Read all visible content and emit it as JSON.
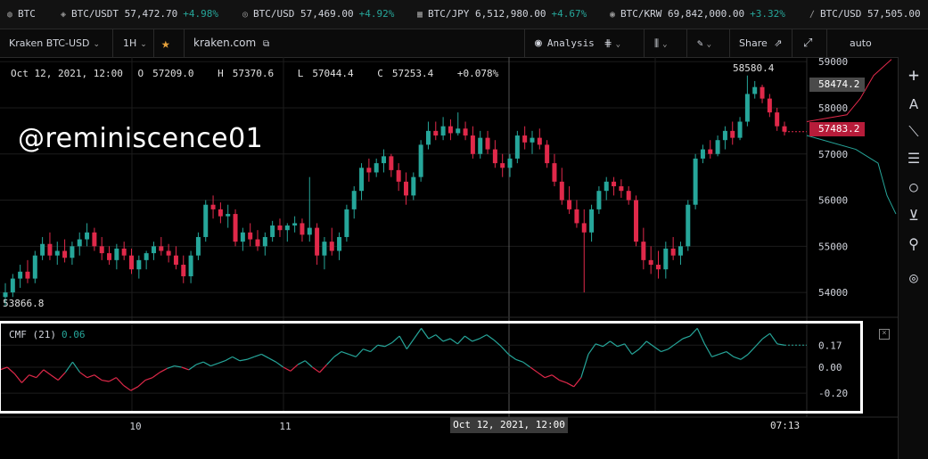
{
  "ticker": [
    {
      "icon": "btc-icon",
      "glyph": "◍",
      "pair": "BTC",
      "price": "",
      "change": ""
    },
    {
      "icon": "usdt-icon",
      "glyph": "◈",
      "pair": "BTC/USDT",
      "price": "57,472.70",
      "change": "+4.98%"
    },
    {
      "icon": "usd-icon",
      "glyph": "◎",
      "pair": "BTC/USD",
      "price": "57,469.00",
      "change": "+4.92%"
    },
    {
      "icon": "jpy-icon",
      "glyph": "▦",
      "pair": "BTC/JPY",
      "price": "6,512,980.00",
      "change": "+4.67%"
    },
    {
      "icon": "krw-icon",
      "glyph": "◉",
      "pair": "BTC/KRW",
      "price": "69,842,000.00",
      "change": "+3.32%"
    },
    {
      "icon": "usd-icon",
      "glyph": "∕",
      "pair": "BTC/USD",
      "price": "57,505.00",
      "change": ""
    }
  ],
  "toolbar": {
    "symbol": "Kraken BTC-USD",
    "interval": "1H",
    "site": "kraken.com",
    "analysis": "Analysis",
    "share": "Share",
    "auto": "auto"
  },
  "ohlc": {
    "date": "Oct 12, 2021, 12:00",
    "o_label": "O",
    "o": "57209.0",
    "h_label": "H",
    "h": "57370.6",
    "l_label": "L",
    "l": "57044.4",
    "c_label": "C",
    "c": "57253.4",
    "change": "+0.078%"
  },
  "watermark": "@reminiscence01",
  "price_labels": {
    "high_marker": "58580.4",
    "low_marker": "53866.8",
    "last_gray": "58474.2",
    "last_red": "57483.2"
  },
  "indicator": {
    "name": "CMF (21)",
    "value": "0.06"
  },
  "crosshair_time": "Oct 12, 2021, 12:00",
  "time_now": "07:13",
  "chart_data": {
    "type": "candlestick",
    "price_axis": {
      "ticks": [
        "59000",
        "58000",
        "57000",
        "56000",
        "55000",
        "54000"
      ],
      "values": [
        59000,
        58000,
        57000,
        56000,
        55000,
        54000
      ],
      "range": [
        53500,
        59100
      ]
    },
    "time_axis": {
      "ticks": [
        "10",
        "11"
      ]
    },
    "candles": [
      [
        53900,
        54200,
        53700,
        54000
      ],
      [
        54000,
        54400,
        53900,
        54300
      ],
      [
        54300,
        54600,
        54100,
        54450
      ],
      [
        54450,
        54700,
        54200,
        54300
      ],
      [
        54300,
        54900,
        54200,
        54800
      ],
      [
        54800,
        55200,
        54700,
        55050
      ],
      [
        55050,
        55300,
        54700,
        54800
      ],
      [
        54800,
        55100,
        54600,
        54900
      ],
      [
        54900,
        55150,
        54650,
        54750
      ],
      [
        54750,
        55100,
        54600,
        55000
      ],
      [
        55000,
        55300,
        54800,
        55150
      ],
      [
        55150,
        55500,
        55000,
        55300
      ],
      [
        55300,
        55400,
        54900,
        55000
      ],
      [
        55000,
        55200,
        54700,
        54850
      ],
      [
        54850,
        55000,
        54600,
        54700
      ],
      [
        54700,
        55050,
        54500,
        54950
      ],
      [
        54950,
        55100,
        54700,
        54800
      ],
      [
        54800,
        54950,
        54400,
        54500
      ],
      [
        54500,
        54800,
        54300,
        54700
      ],
      [
        54700,
        54900,
        54500,
        54850
      ],
      [
        54850,
        55100,
        54700,
        55000
      ],
      [
        55000,
        55200,
        54800,
        54900
      ],
      [
        54900,
        55050,
        54650,
        54800
      ],
      [
        54800,
        55000,
        54500,
        54600
      ],
      [
        54600,
        54800,
        54200,
        54350
      ],
      [
        54350,
        54900,
        54200,
        54800
      ],
      [
        54800,
        55300,
        54700,
        55200
      ],
      [
        55200,
        56000,
        55100,
        55900
      ],
      [
        55900,
        56100,
        55600,
        55800
      ],
      [
        55800,
        55950,
        55500,
        55650
      ],
      [
        55650,
        55900,
        55400,
        55700
      ],
      [
        55700,
        55800,
        55000,
        55100
      ],
      [
        55100,
        55400,
        54900,
        55300
      ],
      [
        55300,
        55500,
        55000,
        55150
      ],
      [
        55150,
        55350,
        54900,
        55000
      ],
      [
        55000,
        55300,
        54800,
        55200
      ],
      [
        55200,
        55550,
        55100,
        55450
      ],
      [
        55450,
        55600,
        55200,
        55350
      ],
      [
        55350,
        55500,
        55100,
        55450
      ],
      [
        55450,
        55650,
        55300,
        55500
      ],
      [
        55500,
        55600,
        55100,
        55250
      ],
      [
        55250,
        56500,
        55100,
        55400
      ],
      [
        55400,
        55500,
        54600,
        54800
      ],
      [
        54800,
        55200,
        54500,
        55100
      ],
      [
        55100,
        55400,
        54800,
        54900
      ],
      [
        54900,
        55300,
        54700,
        55200
      ],
      [
        55200,
        55900,
        55100,
        55800
      ],
      [
        55800,
        56300,
        55600,
        56200
      ],
      [
        56200,
        56800,
        56000,
        56700
      ],
      [
        56700,
        56900,
        56400,
        56600
      ],
      [
        56600,
        56900,
        56500,
        56800
      ],
      [
        56800,
        57100,
        56600,
        56950
      ],
      [
        56950,
        57000,
        56500,
        56650
      ],
      [
        56650,
        56800,
        56200,
        56400
      ],
      [
        56400,
        56600,
        55900,
        56100
      ],
      [
        56100,
        56600,
        56000,
        56500
      ],
      [
        56500,
        57300,
        56400,
        57200
      ],
      [
        57200,
        57700,
        57100,
        57500
      ],
      [
        57500,
        57700,
        57300,
        57400
      ],
      [
        57400,
        57800,
        57300,
        57600
      ],
      [
        57600,
        57750,
        57300,
        57450
      ],
      [
        57450,
        57900,
        57400,
        57550
      ],
      [
        57550,
        57700,
        57300,
        57400
      ],
      [
        57400,
        57600,
        56900,
        57000
      ],
      [
        57000,
        57500,
        56900,
        57350
      ],
      [
        57350,
        57500,
        57000,
        57100
      ],
      [
        57100,
        57300,
        56700,
        56800
      ],
      [
        56800,
        57000,
        56500,
        56700
      ],
      [
        56700,
        57000,
        56500,
        56900
      ],
      [
        56900,
        57500,
        56800,
        57400
      ],
      [
        57400,
        57600,
        57100,
        57250
      ],
      [
        57250,
        57500,
        57000,
        57350
      ],
      [
        57350,
        57550,
        57100,
        57200
      ],
      [
        57200,
        57300,
        56700,
        56800
      ],
      [
        56800,
        57000,
        56300,
        56400
      ],
      [
        56400,
        56700,
        55900,
        56000
      ],
      [
        56000,
        56300,
        55700,
        55800
      ],
      [
        55800,
        56000,
        55400,
        55500
      ],
      [
        55500,
        55800,
        54000,
        55300
      ],
      [
        55300,
        55900,
        55100,
        55800
      ],
      [
        55800,
        56300,
        55700,
        56200
      ],
      [
        56200,
        56500,
        56000,
        56400
      ],
      [
        56400,
        56500,
        56100,
        56300
      ],
      [
        56300,
        56450,
        56050,
        56200
      ],
      [
        56200,
        56300,
        55900,
        56000
      ],
      [
        56000,
        56100,
        55000,
        55100
      ],
      [
        55100,
        55400,
        54500,
        54700
      ],
      [
        54700,
        55000,
        54400,
        54600
      ],
      [
        54600,
        54900,
        54300,
        54500
      ],
      [
        54500,
        55100,
        54300,
        54950
      ],
      [
        54950,
        55200,
        54700,
        54800
      ],
      [
        54800,
        55100,
        54600,
        55000
      ],
      [
        55000,
        56000,
        54900,
        55900
      ],
      [
        55900,
        57000,
        55800,
        56900
      ],
      [
        56900,
        57200,
        56800,
        57100
      ],
      [
        57100,
        57300,
        56900,
        57000
      ],
      [
        57000,
        57400,
        56950,
        57300
      ],
      [
        57300,
        57600,
        57100,
        57500
      ],
      [
        57500,
        57700,
        57200,
        57350
      ],
      [
        57350,
        57800,
        57300,
        57700
      ],
      [
        57700,
        58700,
        57600,
        58300
      ],
      [
        58300,
        58580,
        58200,
        58450
      ],
      [
        58450,
        58500,
        58100,
        58200
      ],
      [
        58200,
        58300,
        57800,
        57900
      ],
      [
        57900,
        58000,
        57500,
        57600
      ],
      [
        57600,
        57700,
        57400,
        57483
      ]
    ],
    "cmf": {
      "ticks": [
        "0.17",
        "0.00",
        "-0.20"
      ],
      "tick_values": [
        0.17,
        0.0,
        -0.2
      ],
      "range": [
        -0.33,
        0.33
      ],
      "values": [
        -0.02,
        0.0,
        -0.05,
        -0.12,
        -0.06,
        -0.08,
        -0.02,
        -0.06,
        -0.1,
        -0.04,
        0.04,
        -0.04,
        -0.08,
        -0.06,
        -0.1,
        -0.11,
        -0.08,
        -0.14,
        -0.18,
        -0.15,
        -0.1,
        -0.08,
        -0.04,
        -0.01,
        0.01,
        0.0,
        -0.02,
        0.02,
        0.04,
        0.01,
        0.03,
        0.05,
        0.08,
        0.05,
        0.06,
        0.08,
        0.1,
        0.07,
        0.04,
        0.0,
        -0.03,
        0.02,
        0.05,
        0.0,
        -0.04,
        0.02,
        0.08,
        0.12,
        0.1,
        0.08,
        0.14,
        0.12,
        0.17,
        0.16,
        0.19,
        0.24,
        0.14,
        0.22,
        0.3,
        0.22,
        0.25,
        0.2,
        0.22,
        0.18,
        0.24,
        0.2,
        0.22,
        0.25,
        0.21,
        0.16,
        0.1,
        0.06,
        0.04,
        0.0,
        -0.04,
        -0.08,
        -0.06,
        -0.1,
        -0.12,
        -0.15,
        -0.08,
        0.1,
        0.18,
        0.16,
        0.2,
        0.16,
        0.18,
        0.1,
        0.14,
        0.2,
        0.16,
        0.12,
        0.14,
        0.18,
        0.22,
        0.24,
        0.3,
        0.18,
        0.08,
        0.1,
        0.12,
        0.08,
        0.06,
        0.1,
        0.16,
        0.22,
        0.26,
        0.18,
        0.17
      ]
    }
  },
  "colors": {
    "up": "#26a69a",
    "down": "#e0294a",
    "bg": "#000000",
    "grid": "#1c1c1c",
    "text": "#d1d4dc"
  }
}
